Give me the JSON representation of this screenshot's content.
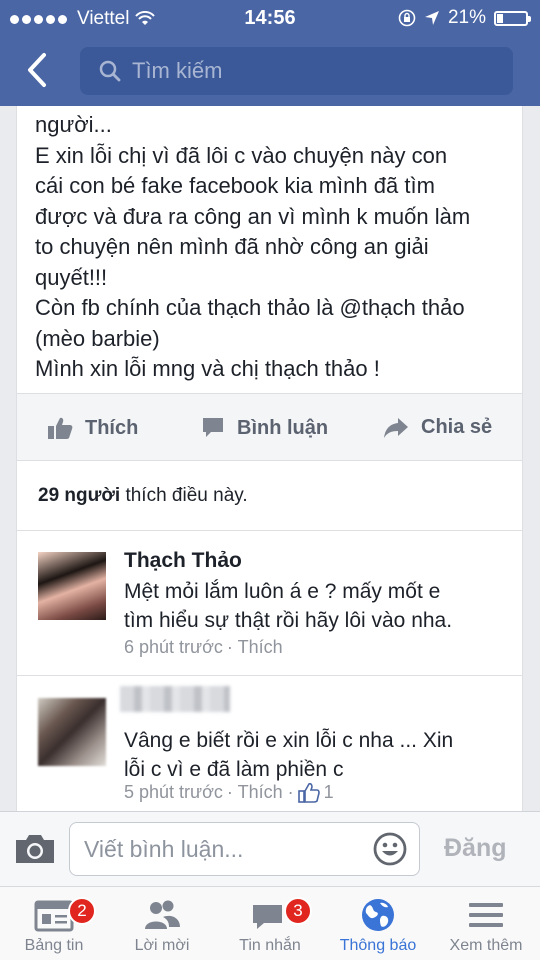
{
  "status_bar": {
    "carrier": "Viettel",
    "time": "14:56",
    "battery": "21%",
    "battery_level": 0.21
  },
  "header": {
    "search_placeholder": "Tìm kiếm"
  },
  "post": {
    "lines": [
      "người...",
      "E xin lỗi chị vì đã lôi c vào chuyện này con",
      "cái con bé fake facebook kia mình đã tìm",
      "được và đưa ra công an vì mình k muốn làm",
      "to chuyện nên mình đã nhờ công an giải",
      "quyết!!!",
      "Còn fb chính của thạch thảo là @thạch thảo",
      "(mèo barbie)",
      "Mình xin lỗi mng và chị thạch thảo !"
    ]
  },
  "actions": {
    "like": "Thích",
    "comment": "Bình luận",
    "share": "Chia sẻ"
  },
  "likes_summary": {
    "count": "29 người",
    "suffix": " thích điều này."
  },
  "comments": [
    {
      "name": "Thạch Thảo",
      "lines": [
        "Mệt mỏi lắm luôn á e ? mấy mốt e",
        "tìm hiểu sự thật rồi hãy lôi vào nha."
      ],
      "time": "6 phút trước",
      "like": "· Thích"
    },
    {
      "name": "",
      "lines": [
        "Vâng e biết rồi e xin lỗi c nha ... Xin",
        "lỗi c vì e đã làm phiền c"
      ],
      "time": "5 phút trước",
      "like": "· Thích ·",
      "like_count": "1"
    }
  ],
  "composer": {
    "placeholder": "Viết bình luận...",
    "post_label": "Đăng"
  },
  "tabs": [
    {
      "label": "Bảng tin",
      "badge": "2"
    },
    {
      "label": "Lời mời"
    },
    {
      "label": "Tin nhắn",
      "badge": "3"
    },
    {
      "label": "Thông báo",
      "active": true
    },
    {
      "label": "Xem thêm"
    }
  ],
  "colors": {
    "header": "#4a66a4",
    "search": "#3b5998",
    "active_tab": "#3a74d6",
    "badge": "#e0261f"
  }
}
